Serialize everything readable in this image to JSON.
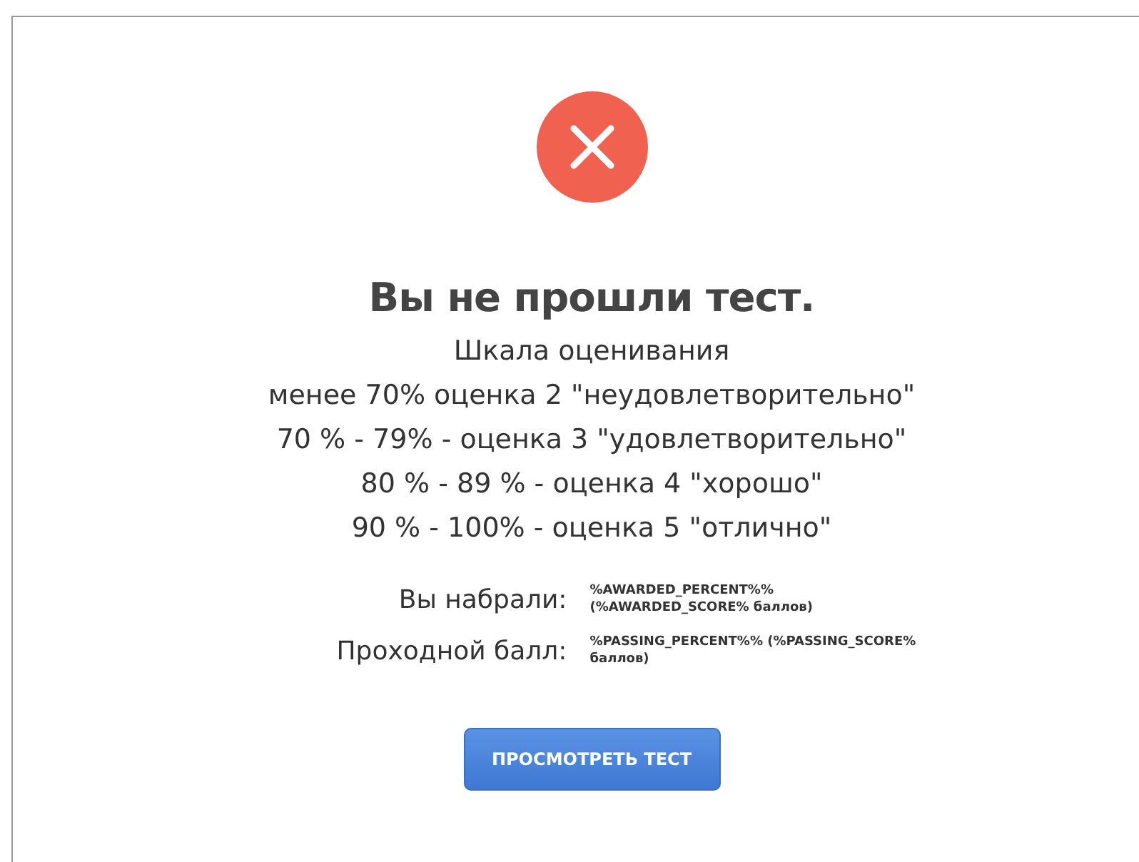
{
  "status": {
    "kind": "failed"
  },
  "title": "Вы не прошли тест.",
  "scale_lines": [
    "Шкала оценивания",
    "менее 70% оценка 2 \"неудовлетворительно\"",
    "70 % - 79% - оценка 3 \"удовлетворительно\"",
    "80 % - 89 % - оценка 4 \"хорошо\"",
    "90 % - 100% - оценка 5 \"отлично\""
  ],
  "results": [
    {
      "label": "Вы набрали:",
      "value": "%AWARDED_PERCENT%% (%AWARDED_SCORE% баллов)"
    },
    {
      "label": "Проходной балл:",
      "value": "%PASSING_PERCENT%% (%PASSING_SCORE% баллов)"
    }
  ],
  "button": "ПРОСМОТРЕТЬ ТЕСТ"
}
